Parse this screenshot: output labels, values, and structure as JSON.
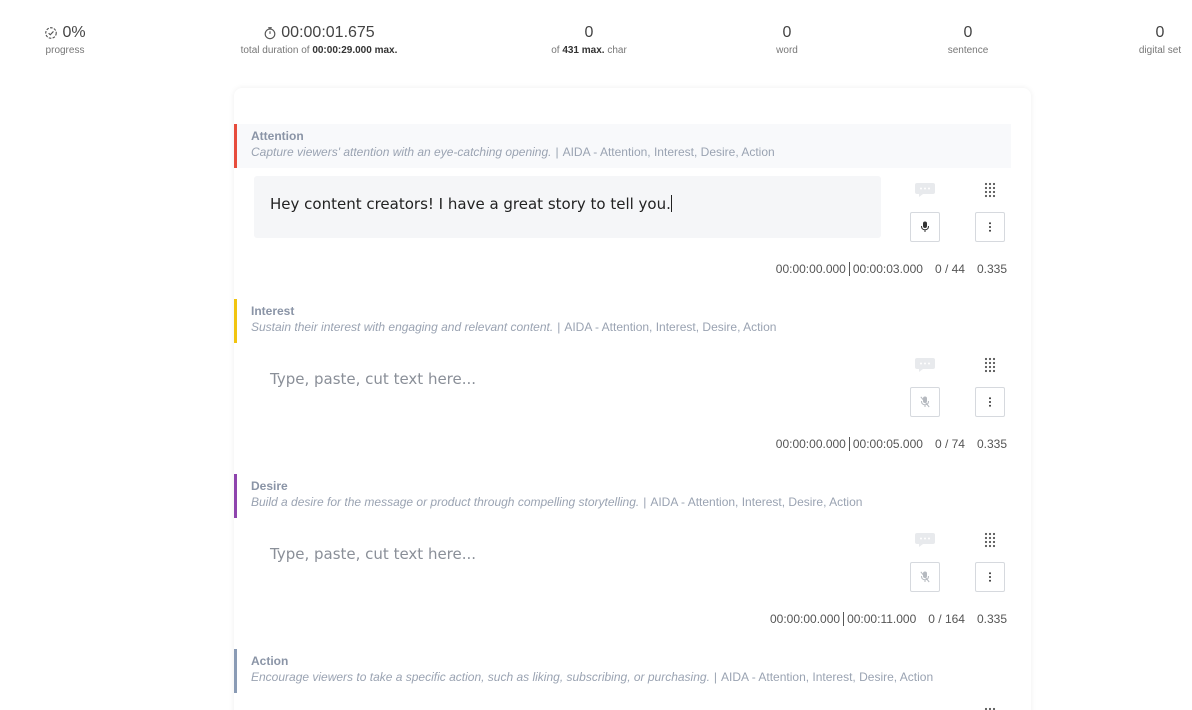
{
  "stats": {
    "progress": {
      "value": "0%",
      "label": "progress"
    },
    "duration": {
      "value": "00:00:01.675",
      "label_prefix": "total duration of",
      "max": "00:00:29.000 max."
    },
    "chars": {
      "value": "0",
      "label_prefix": "of",
      "max": "431 max.",
      "label_suffix": "char"
    },
    "words": {
      "value": "0",
      "label": "word"
    },
    "sentences": {
      "value": "0",
      "label": "sentence"
    },
    "digital_set": {
      "value": "0",
      "label": "digital set"
    }
  },
  "sections": [
    {
      "title": "Attention",
      "desc": "Capture viewers' attention with an eye-catching opening.",
      "tag": "AIDA - Attention, Interest, Desire, Action",
      "color": "#e74c3c",
      "text": "Hey content creators! I have a great story to tell you.",
      "placeholder": "",
      "start": "00:00:00.000",
      "end": "00:00:03.000",
      "count": "0 / 44",
      "rate": "0.335"
    },
    {
      "title": "Interest",
      "desc": "Sustain their interest with engaging and relevant content.",
      "tag": "AIDA - Attention, Interest, Desire, Action",
      "color": "#f1c40f",
      "text": "",
      "placeholder": "Type, paste, cut text here...",
      "start": "00:00:00.000",
      "end": "00:00:05.000",
      "count": "0 / 74",
      "rate": "0.335"
    },
    {
      "title": "Desire",
      "desc": "Build a desire for the message or product through compelling storytelling.",
      "tag": "AIDA - Attention, Interest, Desire, Action",
      "color": "#8e44ad",
      "text": "",
      "placeholder": "Type, paste, cut text here...",
      "start": "00:00:00.000",
      "end": "00:00:11.000",
      "count": "0 / 164",
      "rate": "0.335"
    },
    {
      "title": "Action",
      "desc": "Encourage viewers to take a specific action, such as liking, subscribing, or purchasing.",
      "tag": "AIDA - Attention, Interest, Desire, Action",
      "color": "#8a9bb5"
    }
  ],
  "icons": {
    "progress": "check-circle-icon",
    "duration": "stopwatch-icon",
    "chat": "chat-bubble-icon",
    "grid": "drag-grid-icon",
    "mic": "microphone-icon",
    "mic_off": "microphone-off-icon",
    "more": "more-vertical-icon"
  }
}
